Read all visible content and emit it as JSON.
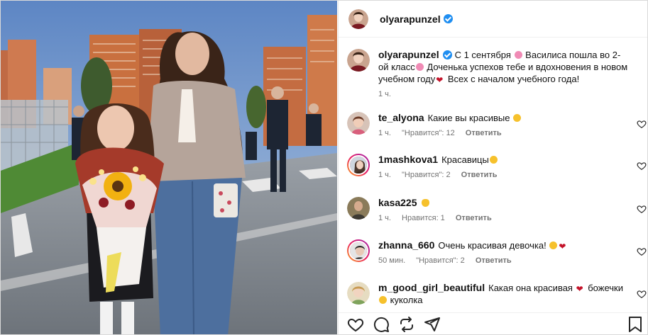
{
  "post": {
    "author": "olyarapunzel",
    "verified": true,
    "caption": "С 1 сентября 💐 Василиса пошла во 2-ой класс🌸 Доченька успехов тебе и вдохновения в новом учебном году❤️ Всех с началом учебного года!",
    "caption_parts": {
      "p1": "С 1 сентября",
      "p2": "Василиса пошла во 2-ой класс",
      "p3": "Доченька успехов тебе и вдохновения в новом учебном году",
      "p4": "Всех с началом учебного года!"
    },
    "time": "1 ч."
  },
  "comments": [
    {
      "user": "te_alyona",
      "text": "Какие вы красивые",
      "emoji": "smile",
      "time": "1 ч.",
      "likes": "\"Нравится\": 12",
      "reply": "Ответить"
    },
    {
      "user": "1mashkova1",
      "text": "Красавицы",
      "emoji": "smile",
      "time": "1 ч.",
      "likes": "\"Нравится\": 2",
      "reply": "Ответить"
    },
    {
      "user": "kasa225",
      "text": "",
      "emoji": "hand",
      "time": "1 ч.",
      "likes": "Нравится: 1",
      "reply": "Ответить"
    },
    {
      "user": "zhanna_660",
      "text": "Очень красивая девочка!",
      "emoji": "smile-heart",
      "time": "50 мин.",
      "likes": "\"Нравится\": 2",
      "reply": "Ответить"
    },
    {
      "user": "m_good_girl_beautiful",
      "text": "Какая она красивая",
      "text2": "божечки",
      "text3": "куколка",
      "emoji": "heart",
      "time": "",
      "likes": "",
      "reply": ""
    }
  ],
  "icons": {
    "like": "heart-icon",
    "comment": "comment-icon",
    "share": "repost-icon",
    "send": "send-icon",
    "save": "bookmark-icon"
  },
  "colors": {
    "verified": "#1f8ef1",
    "heart": "#c4132a",
    "meta": "#737373"
  }
}
